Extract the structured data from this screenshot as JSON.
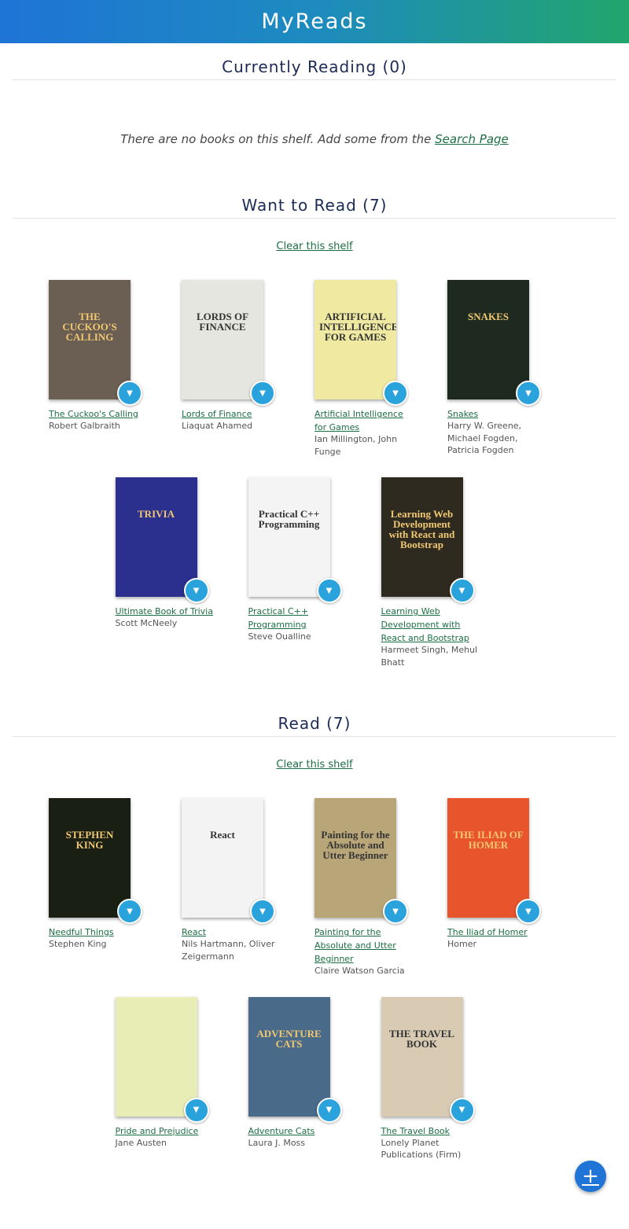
{
  "app": {
    "title": "MyReads"
  },
  "shelves": {
    "current": {
      "title": "Currently Reading (0)",
      "empty_text": "There are no books on this shelf. Add some from the",
      "empty_link": "Search Page"
    },
    "want": {
      "title": "Want to Read (7)",
      "clear_label": "Clear this shelf",
      "books": [
        {
          "title": "The Cuckoo's Calling",
          "authors": "Robert Galbraith",
          "cover_color": "#6b5e52",
          "cover_text": "THE CUCKOO'S CALLING"
        },
        {
          "title": "Lords of Finance",
          "authors": "Liaquat Ahamed",
          "cover_color": "#e6e6e0",
          "cover_text": "LORDS OF FINANCE"
        },
        {
          "title": "Artificial Intelligence for Games",
          "authors": "Ian Millington, John Funge",
          "cover_color": "#efe9a2",
          "cover_text": "ARTIFICIAL INTELLIGENCE FOR GAMES"
        },
        {
          "title": "Snakes",
          "authors": "Harry W. Greene, Michael Fogden, Patricia Fogden",
          "cover_color": "#1e2a20",
          "cover_text": "SNAKES"
        },
        {
          "title": "Ultimate Book of Trivia",
          "authors": "Scott McNeely",
          "cover_color": "#2b2f8e",
          "cover_text": "TRIVIA"
        },
        {
          "title": "Practical C++ Programming",
          "authors": "Steve Oualline",
          "cover_color": "#f4f4f4",
          "cover_text": "Practical C++ Programming"
        },
        {
          "title": "Learning Web Development with React and Bootstrap",
          "authors": "Harmeet Singh, Mehul Bhatt",
          "cover_color": "#2f2a20",
          "cover_text": "Learning Web Development with React and Bootstrap"
        }
      ]
    },
    "read": {
      "title": "Read (7)",
      "clear_label": "Clear this shelf",
      "books": [
        {
          "title": "Needful Things",
          "authors": "Stephen King",
          "cover_color": "#1a1f14",
          "cover_text": "STEPHEN KING"
        },
        {
          "title": "React",
          "authors": "Nils Hartmann, Oliver Zeigermann",
          "cover_color": "#f3f3f3",
          "cover_text": "React"
        },
        {
          "title": "Painting for the Absolute and Utter Beginner",
          "authors": "Claire Watson Garcia",
          "cover_color": "#b9a678",
          "cover_text": "Painting for the Absolute and Utter Beginner"
        },
        {
          "title": "The Iliad of Homer",
          "authors": "Homer",
          "cover_color": "#e8542c",
          "cover_text": "THE ILIAD OF HOMER"
        },
        {
          "title": "Pride and Prejudice",
          "authors": "Jane Austen",
          "cover_color": "#e7edb5",
          "cover_text": ""
        },
        {
          "title": "Adventure Cats",
          "authors": "Laura J. Moss",
          "cover_color": "#4a6a8a",
          "cover_text": "ADVENTURE CATS"
        },
        {
          "title": "The Travel Book",
          "authors": "Lonely Planet Publications (Firm)",
          "cover_color": "#d9cbb3",
          "cover_text": "THE TRAVEL BOOK"
        }
      ]
    }
  },
  "colors": {
    "accent": "#2aa3dc",
    "link": "#1c6f43",
    "header_start": "#1f74d6",
    "header_end": "#22a56d"
  },
  "icons": {
    "shelf_changer": "arrow-drop-down-icon",
    "add": "plus-icon"
  }
}
